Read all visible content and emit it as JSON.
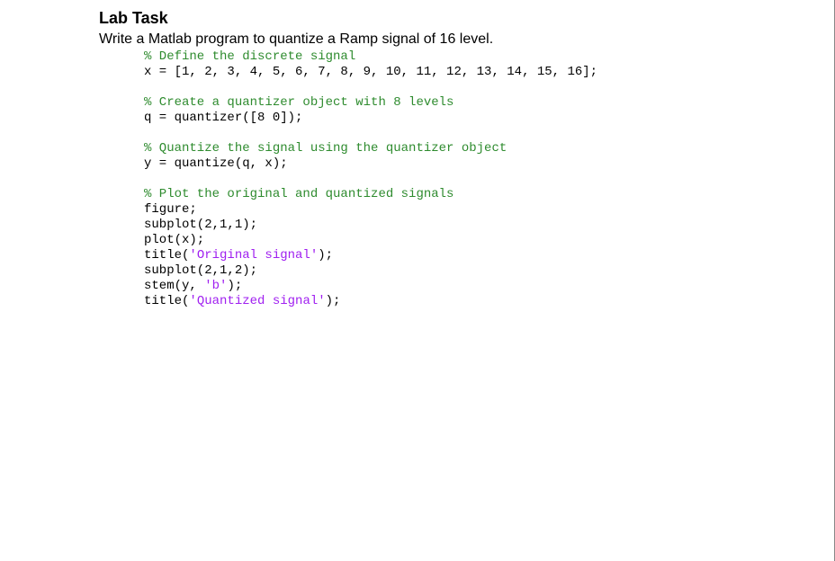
{
  "title": "Lab Task",
  "description": "Write a Matlab program to quantize a Ramp signal of 16 level.",
  "code": {
    "c1": "% Define the discrete signal",
    "l1": "x = [1, 2, 3, 4, 5, 6, 7, 8, 9, 10, 11, 12, 13, 14, 15, 16];",
    "c2": "% Create a quantizer object with 8 levels",
    "l2": "q = quantizer([8 0]);",
    "c3": "% Quantize the signal using the quantizer object",
    "l3": "y = quantize(q, x);",
    "c4": "% Plot the original and quantized signals",
    "l4": "figure;",
    "l5": "subplot(2,1,1);",
    "l6": "plot(x);",
    "l7a": "title(",
    "s1": "'Original signal'",
    "l7b": ");",
    "l8": "subplot(2,1,2);",
    "l9a": "stem(y, ",
    "s2": "'b'",
    "l9b": ");",
    "l10a": "title(",
    "s3": "'Quantized signal'",
    "l10b": ");"
  }
}
